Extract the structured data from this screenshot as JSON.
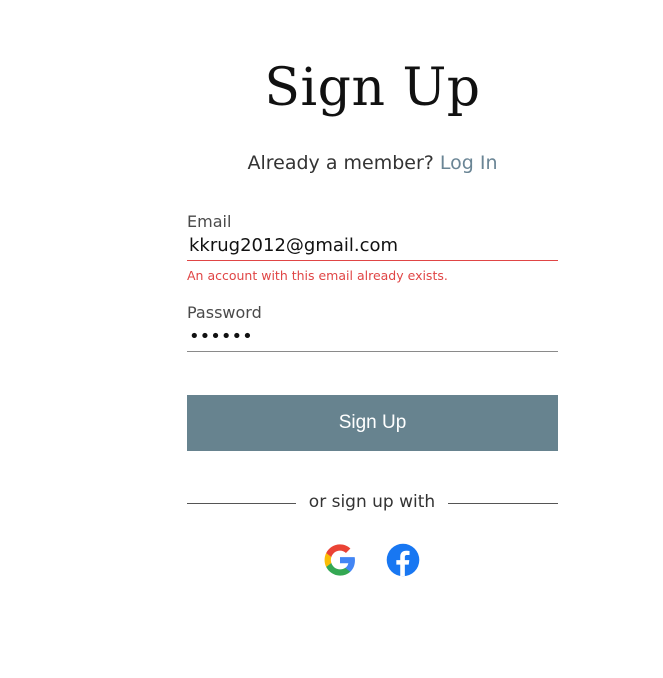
{
  "heading": "Sign Up",
  "member_prompt": "Already a member?",
  "login_link": "Log In",
  "email": {
    "label": "Email",
    "value": "kkrug2012@gmail.com",
    "error": "An account with this email already exists."
  },
  "password": {
    "label": "Password",
    "value": "••••••"
  },
  "submit_label": "Sign Up",
  "divider_text": "or sign up with",
  "social": [
    {
      "icon": "google-icon"
    },
    {
      "icon": "facebook-icon"
    }
  ],
  "colors": {
    "button": "#67838f",
    "link": "#6a8595",
    "error": "#e04545",
    "facebook": "#1877f2"
  }
}
